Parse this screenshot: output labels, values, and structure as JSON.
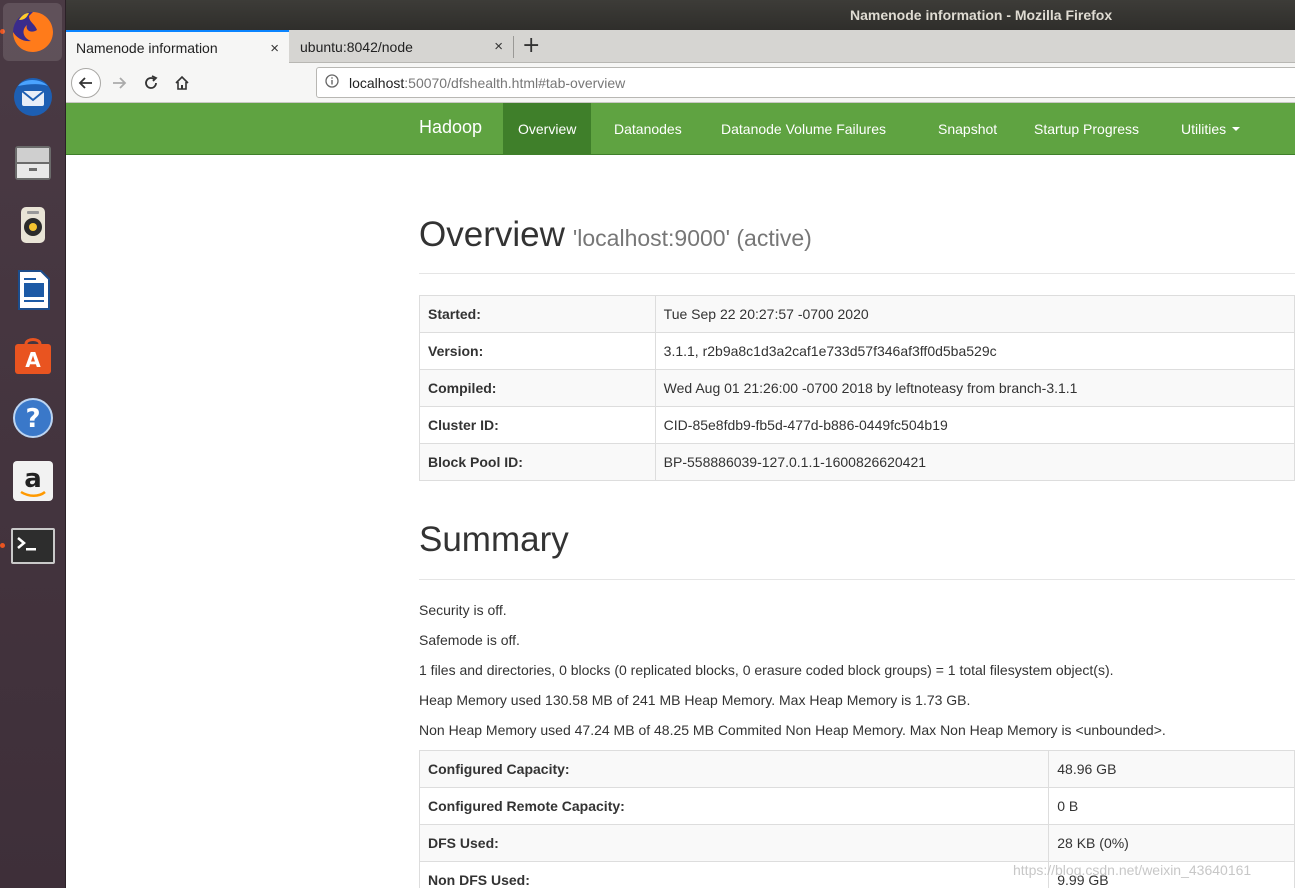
{
  "window": {
    "title": "Namenode information - Mozilla Firefox"
  },
  "tabs": [
    {
      "label": "Namenode information",
      "close": "×"
    },
    {
      "label": "ubuntu:8042/node",
      "close": "×"
    }
  ],
  "newtab": "+",
  "url": {
    "host": "localhost",
    "path": ":50070/dfshealth.html#tab-overview"
  },
  "header": {
    "brand": "Hadoop",
    "nav": [
      "Overview",
      "Datanodes",
      "Datanode Volume Failures",
      "Snapshot",
      "Startup Progress",
      "Utilities"
    ]
  },
  "overview": {
    "title": "Overview",
    "subtitle": "'localhost:9000' (active)",
    "rows": [
      {
        "k": "Started:",
        "v": "Tue Sep 22 20:27:57 -0700 2020"
      },
      {
        "k": "Version:",
        "v": "3.1.1, r2b9a8c1d3a2caf1e733d57f346af3ff0d5ba529c"
      },
      {
        "k": "Compiled:",
        "v": "Wed Aug 01 21:26:00 -0700 2018 by leftnoteasy from branch-3.1.1"
      },
      {
        "k": "Cluster ID:",
        "v": "CID-85e8fdb9-fb5d-477d-b886-0449fc504b19"
      },
      {
        "k": "Block Pool ID:",
        "v": "BP-558886039-127.0.1.1-1600826620421"
      }
    ]
  },
  "summary": {
    "title": "Summary",
    "lines": [
      "Security is off.",
      "Safemode is off.",
      "1 files and directories, 0 blocks (0 replicated blocks, 0 erasure coded block groups) = 1 total filesystem object(s).",
      "Heap Memory used 130.58 MB of 241 MB Heap Memory. Max Heap Memory is 1.73 GB.",
      "Non Heap Memory used 47.24 MB of 48.25 MB Commited Non Heap Memory. Max Non Heap Memory is <unbounded>."
    ],
    "rows": [
      {
        "k": "Configured Capacity:",
        "v": "48.96 GB"
      },
      {
        "k": "Configured Remote Capacity:",
        "v": "0 B"
      },
      {
        "k": "DFS Used:",
        "v": "28 KB (0%)"
      },
      {
        "k": "Non DFS Used:",
        "v": "9.99 GB"
      }
    ]
  },
  "watermark": "https://blog.csdn.net/weixin_43640161",
  "launcher": [
    "firefox-icon",
    "thunderbird-icon",
    "files-icon",
    "rhythmbox-icon",
    "writer-icon",
    "software-icon",
    "help-icon",
    "amazon-icon",
    "terminal-icon"
  ]
}
